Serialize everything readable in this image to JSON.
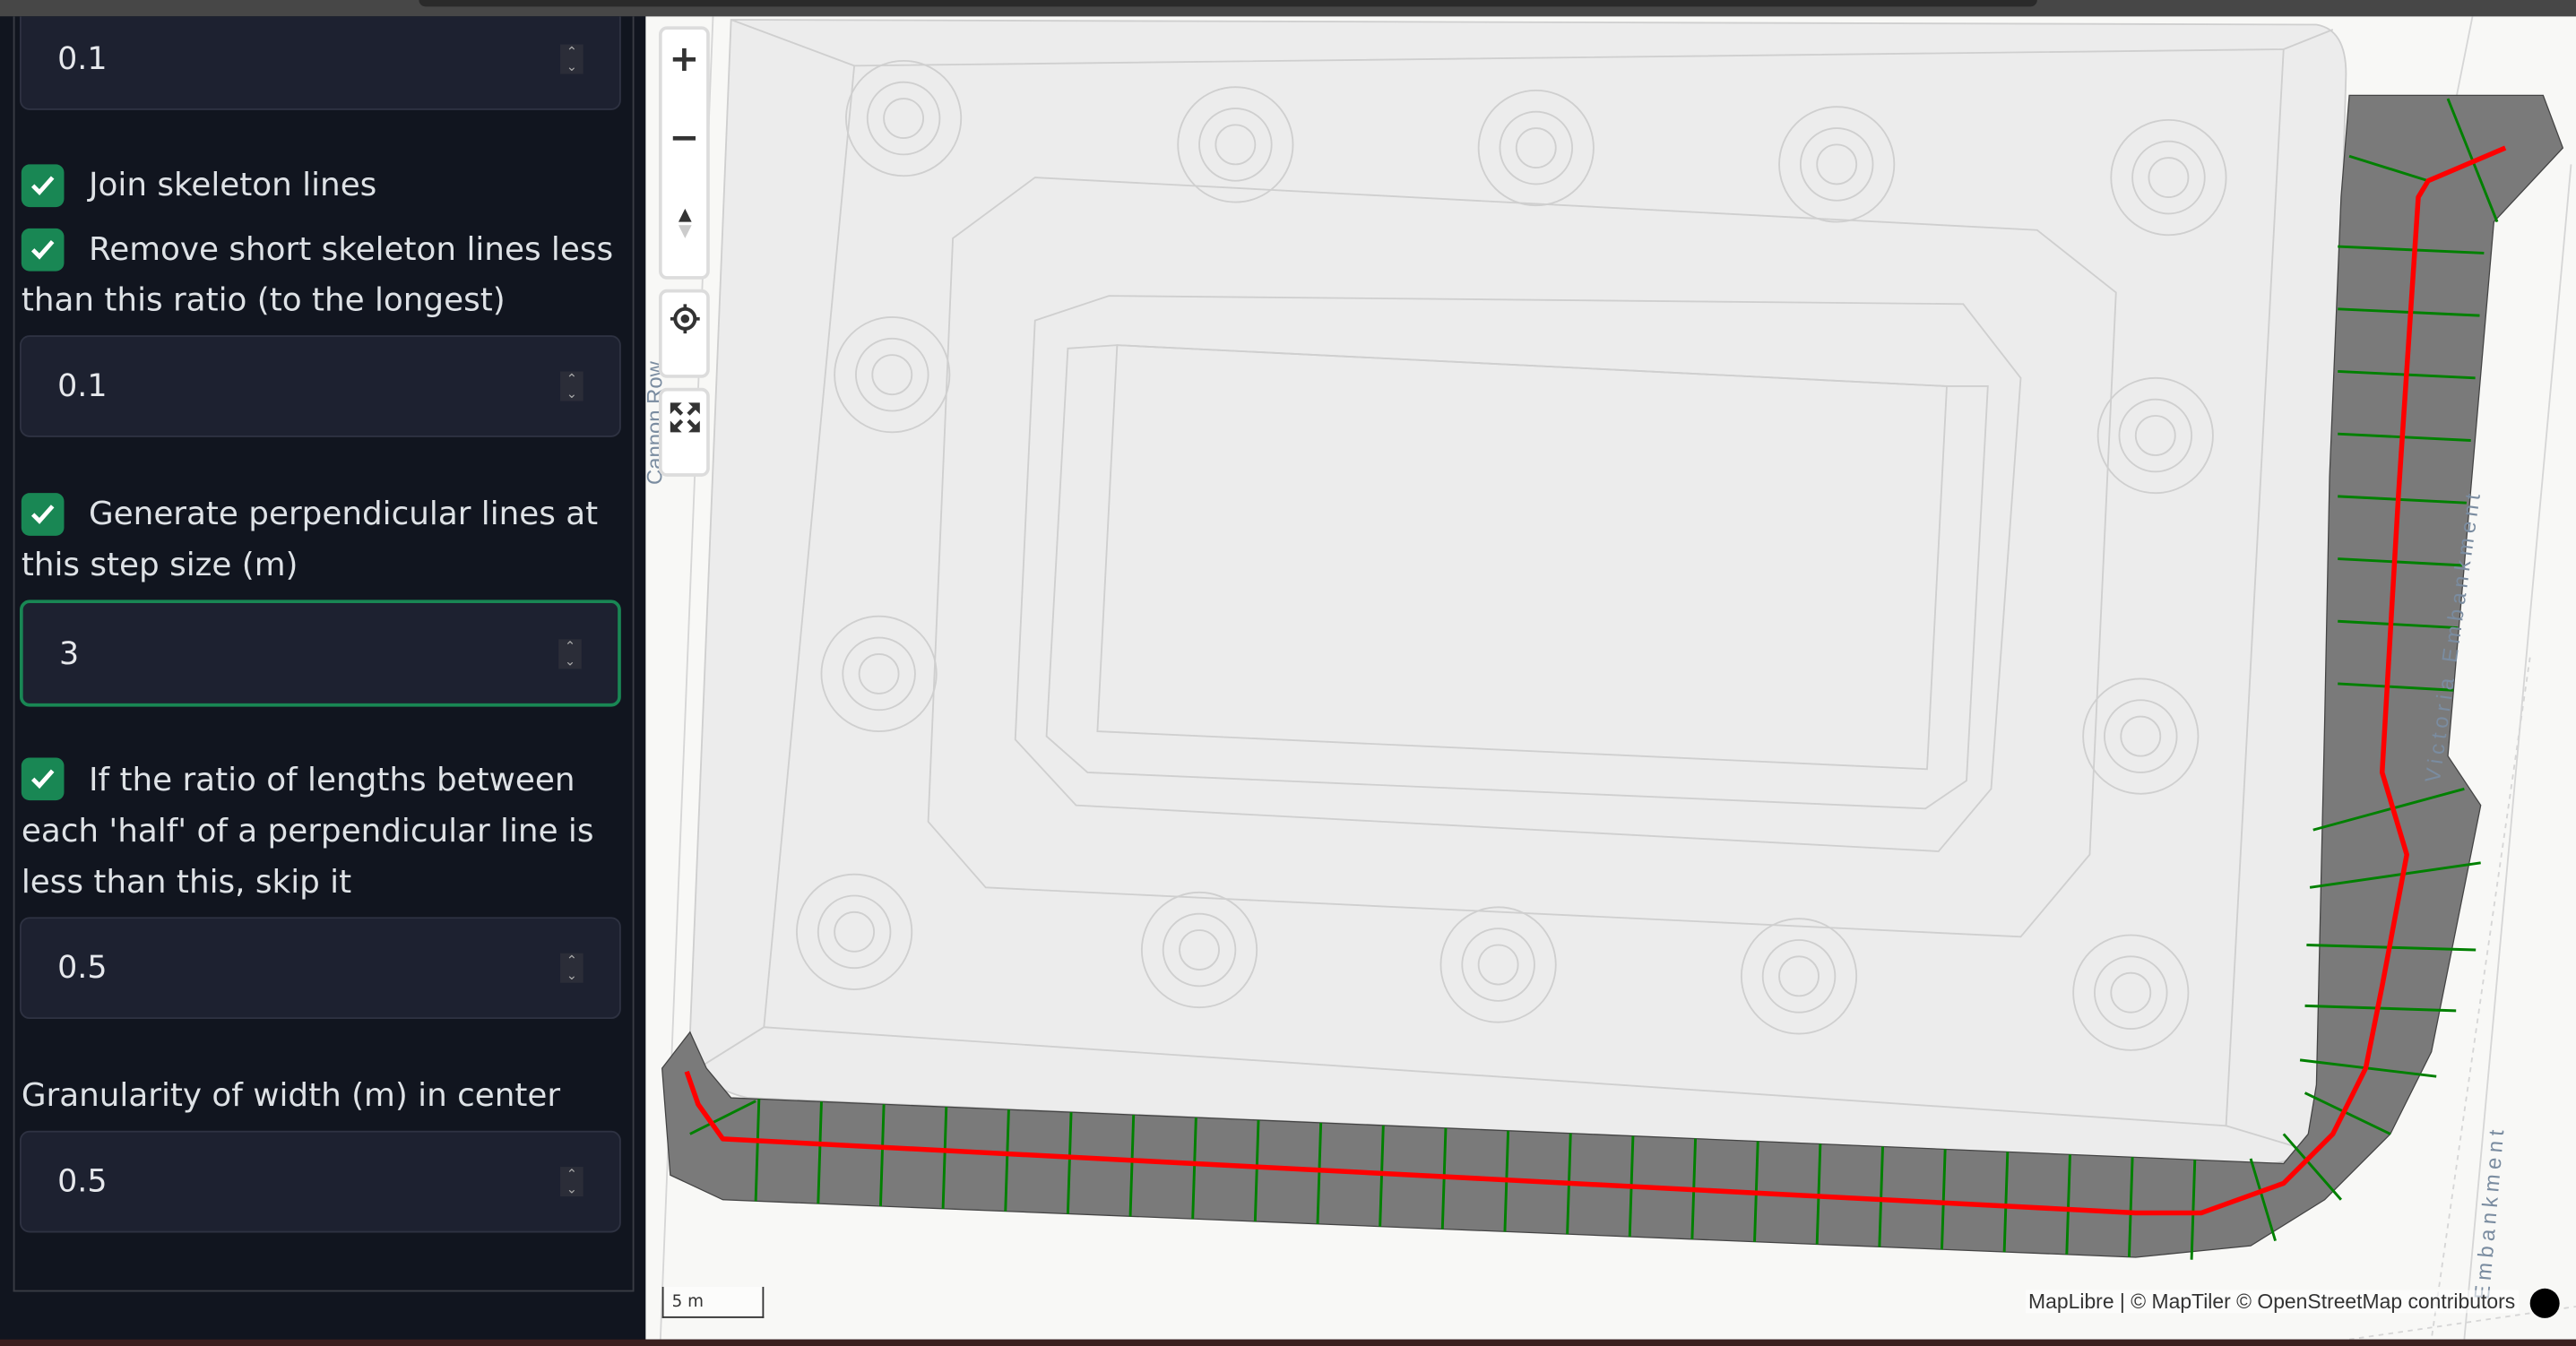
{
  "sidebar": {
    "fields": [
      {
        "value": "0.1"
      },
      {
        "value": "0.1"
      },
      {
        "value": "3"
      },
      {
        "value": "0.5"
      },
      {
        "value": "0.5"
      }
    ],
    "checkboxes": [
      {
        "label": "Join skeleton lines",
        "checked": true
      },
      {
        "label": "Remove short skeleton lines less than this ratio (to the longest)",
        "checked": true
      },
      {
        "label": "Generate perpendicular lines at this step size (m)",
        "checked": true
      },
      {
        "label": "If the ratio of lengths between each 'half' of a perpendicular line is less than this, skip it",
        "checked": true
      }
    ],
    "granularity_label": "Granularity of width (m) in center lines"
  },
  "map": {
    "controls": {
      "zoom_in": "+",
      "zoom_out": "−"
    },
    "road_labels": {
      "right": "Victoria Embankment",
      "lower_right": "Embankment",
      "left": "Cannon Row"
    },
    "scale_label": "5 m",
    "attribution": "MapLibre | © MapTiler © OpenStreetMap contributors",
    "colors": {
      "road_area": "#7a7a7a",
      "center_line": "#ff0000",
      "perpendicular_lines": "#008000",
      "building": "#ececec",
      "accent": "#198754"
    }
  }
}
